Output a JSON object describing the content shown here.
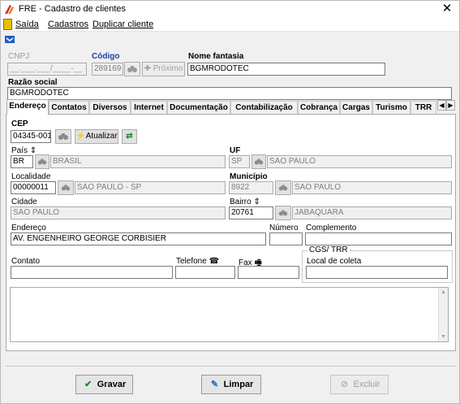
{
  "window": {
    "title": "FRE - Cadastro de clientes",
    "close_glyph": "✕"
  },
  "menu": {
    "items": [
      "Saída",
      "Cadastros",
      "Duplicar cliente"
    ]
  },
  "header": {
    "cnpj_label": "CNPJ",
    "cnpj_value": "__.___.___/____-__",
    "codigo_label": "Código",
    "codigo_value": "289169",
    "proximo_label": "Próximo",
    "nome_fantasia_label": "Nome fantasia",
    "nome_fantasia_value": "BGMRODOTEC",
    "razao_social_label": "Razão social",
    "razao_social_value": "BGMRODOTEC"
  },
  "tabs": [
    "Endereço",
    "Contatos",
    "Diversos",
    "Internet",
    "Documentação",
    "Contabilização",
    "Cobrança",
    "Cargas",
    "Turismo",
    "TRR"
  ],
  "tab_scroll": {
    "left": "◀",
    "right": "▶"
  },
  "endereco": {
    "cep_label": "CEP",
    "cep_value": "04345-001",
    "atualizar_label": "Atualizar",
    "pais_label": "País",
    "pais_code": "BR",
    "pais_name": "BRASIL",
    "uf_label": "UF",
    "uf_code": "SP",
    "uf_name": "SAO PAULO",
    "localidade_label": "Localidade",
    "localidade_code": "00000011",
    "localidade_name": "SAO PAULO - SP",
    "municipio_label": "Município",
    "municipio_code": "8922",
    "municipio_name": "SAO PAULO",
    "cidade_label": "Cidade",
    "cidade_value": "SAO PAULO",
    "bairro_label": "Bairro",
    "bairro_code": "20761",
    "bairro_name": "JABAQUARA",
    "endereco_label": "Endereço",
    "endereco_value": "AV. ENGENHEIRO GEORGE CORBISIER",
    "numero_label": "Número",
    "numero_value": "",
    "complemento_label": "Complemento",
    "complemento_value": "",
    "contato_label": "Contato",
    "contato_value": "",
    "telefone_label": "Telefone",
    "telefone_value": "",
    "fax_label": "Fax",
    "fax_value": "",
    "cgs_trr_label": "CGS/ TRR",
    "local_coleta_label": "Local de coleta",
    "local_coleta_value": ""
  },
  "footer": {
    "gravar_label": "Gravar",
    "limpar_label": "Limpar",
    "excluir_label": "Excluir"
  },
  "colors": {
    "blue_label": "#1f3fa0",
    "accent_red": "#d62a1a",
    "accent_green": "#1d8a2a"
  },
  "icons": [
    "app-icon",
    "exit-icon",
    "toolbar-icon",
    "binoculars-icon",
    "plus-icon",
    "lightning-icon",
    "refresh-icon",
    "sort-icon",
    "phone-icon",
    "fax-icon",
    "check-icon",
    "eraser-icon",
    "delete-icon"
  ]
}
